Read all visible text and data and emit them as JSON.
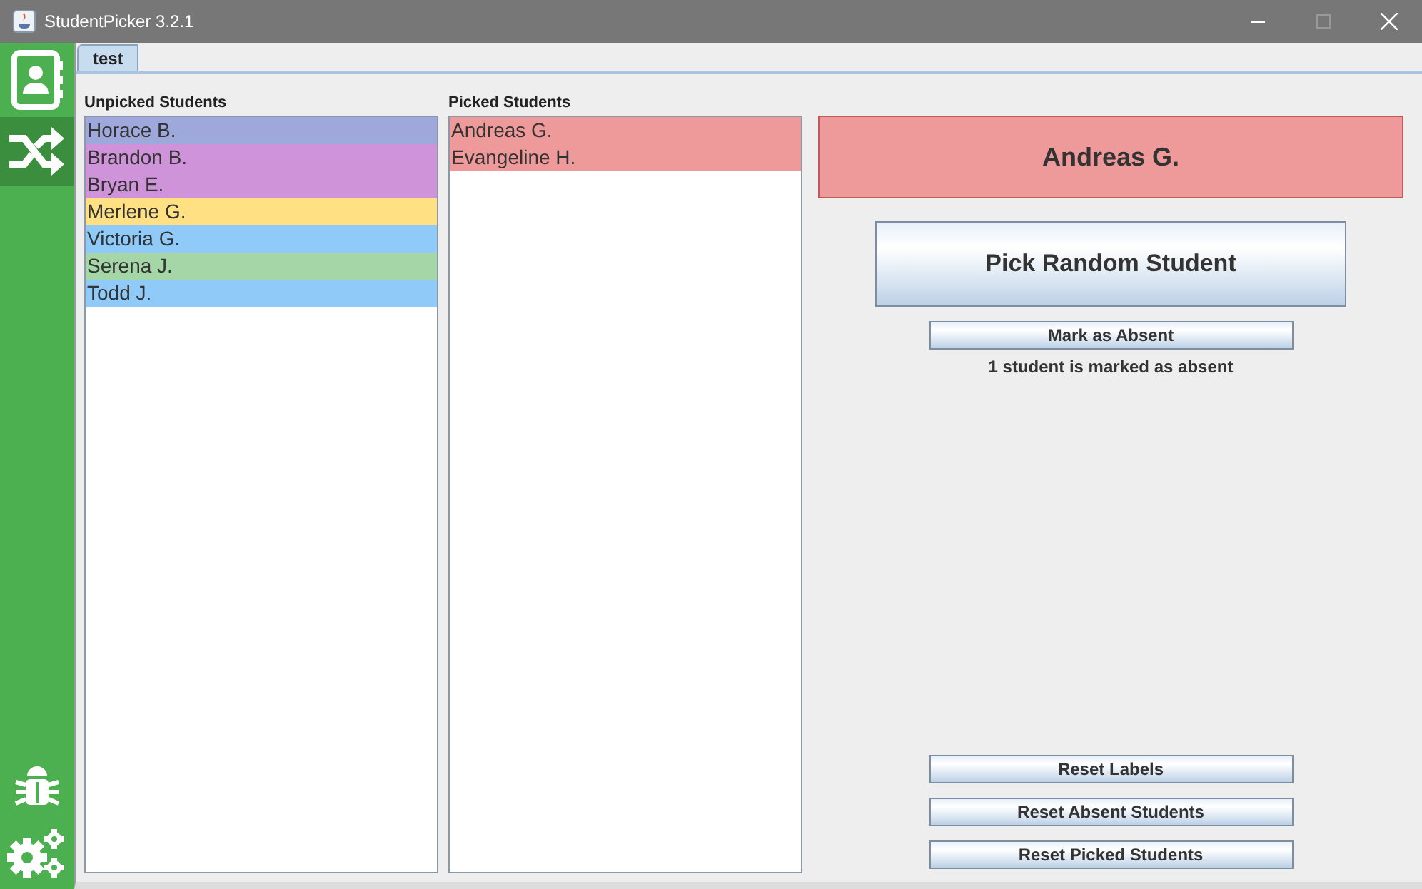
{
  "window": {
    "title": "StudentPicker 3.2.1"
  },
  "sidebar": {
    "items": [
      {
        "kind": "contacts",
        "selected": false
      },
      {
        "kind": "shuffle",
        "selected": true
      },
      {
        "kind": "bug",
        "selected": false
      },
      {
        "kind": "settings",
        "selected": false
      }
    ]
  },
  "tabs": [
    {
      "label": "test",
      "selected": true
    }
  ],
  "unpicked": {
    "title": "Unpicked Students",
    "students": [
      {
        "name": "Horace B.",
        "color": "#9fa8da"
      },
      {
        "name": "Brandon B.",
        "color": "#ce93d8"
      },
      {
        "name": "Bryan E.",
        "color": "#ce93d8"
      },
      {
        "name": "Merlene G.",
        "color": "#ffe082"
      },
      {
        "name": "Victoria G.",
        "color": "#90caf9"
      },
      {
        "name": "Serena J.",
        "color": "#a5d6a7"
      },
      {
        "name": "Todd J.",
        "color": "#90caf9"
      }
    ]
  },
  "picked": {
    "title": "Picked Students",
    "students": [
      {
        "name": "Andreas G.",
        "color": "#ef9a9a"
      },
      {
        "name": "Evangeline H.",
        "color": "#ef9a9a"
      }
    ]
  },
  "current": {
    "name": "Andreas G.",
    "color": "#ef9a9a"
  },
  "pick_button": "Pick Random Student",
  "absent_button": "Mark as Absent",
  "absent_status": "1 student is marked as absent",
  "reset_buttons": [
    "Reset Labels",
    "Reset Absent Students",
    "Reset Picked Students"
  ]
}
